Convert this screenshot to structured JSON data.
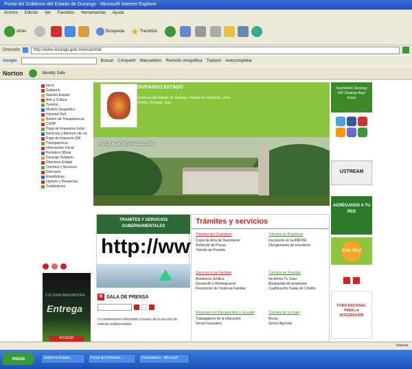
{
  "window": {
    "title": "Portal del Gobierno del Estado de Durango - Microsoft Internet Explorer"
  },
  "menu": [
    "Archivo",
    "Edición",
    "Ver",
    "Favoritos",
    "Herramientas",
    "Ayuda"
  ],
  "toolbar": {
    "back": "Atrás",
    "search": "Búsqueda",
    "favorites": "Favoritos"
  },
  "address": {
    "label": "Dirección",
    "url": "http://www.durango.gob.mx/es/portal/"
  },
  "google": {
    "label": "Google",
    "search_btn": "Buscar",
    "items": [
      "Compartir",
      "Marcadores",
      "Revisión ortográfica",
      "Traducir",
      "Autocompletar"
    ]
  },
  "norton": {
    "label": "Norton",
    "safe_web": "Identity Safe"
  },
  "leftnav": {
    "items": [
      "Inicio",
      "Gobierno",
      "Nuestro Estado",
      "Arte y Cultura",
      "Turismo",
      "Modelo Geográfico",
      "Historial Civil",
      "Boletín de Transparencia",
      "CURP",
      "Pago de Impuestos Estat.",
      "Servicios y Atención de ciu.",
      "Pago de Impuesto ISN",
      "Transparencia",
      "Información Fiscal",
      "Periódico Oficial",
      "Durango Solidario",
      "Directorio Estatal",
      "Trámites y Servicios",
      "Directorio",
      "Estadísticas",
      "Opinión y Denuncias",
      "Contáctenos"
    ]
  },
  "banner": {
    "line1": "CULTURA INNOVADORA",
    "line2": "Entrega",
    "btn": "ACCESO"
  },
  "header": {
    "title": "DURANGO ESTADO",
    "text": "Gobierno del Estado de Durango, Palacio de Gobierno, Zona Centro, Durango, Dgo."
  },
  "photo": {
    "label": "HACIENDA DE GUADALUPE"
  },
  "tramites_banner": {
    "line1": "TRAMITES Y SERVICIOS",
    "line2": "GUBERNAMENTALES",
    "http": "http://www"
  },
  "sala": {
    "icon": "N",
    "title": "SALA DE PRENSA",
    "text": "Lo mantenemos informado a través de la sección de noticias institucionales."
  },
  "tramites": {
    "title": "Trámites y servicios",
    "sections": [
      {
        "heading": "Trámites del Ciudadano",
        "items": [
          "Copia de Acta de Nacimiento",
          "Refrendo de Placas",
          "Trámite de Pensión"
        ]
      },
      {
        "heading": "Trámites de Empresas",
        "items": [
          "Inscripción en la ANFIDE",
          "Otorgamiento de Incentivos"
        ]
      },
      {
        "heading": "Servicios a las Familias",
        "items": [
          "Asistencia Jurídica",
          "Desarrollo y Reintegración",
          "Prevención de Violencia Familiar"
        ]
      },
      {
        "heading": "Trámites de Vivienda",
        "items": [
          "Iniciemos Tu Casa",
          "Búsquedas de propiedad",
          "Cualificación Casas de Crédito"
        ]
      },
      {
        "heading": "Personas con Discapacidad y 3a edad",
        "items": [
          "Trabajadores de la educación",
          "Sector Ganadero"
        ]
      },
      {
        "heading": "Trámites de la mujer",
        "items": [
          "Becas",
          "Sector Agrícola"
        ]
      }
    ]
  },
  "right": {
    "top": "Nacimiento Durango 450 Durango Aquí Estoy",
    "ustream": "USTREAM",
    "green": "AGRÉGANOS A TU RED",
    "cuc": "CUC 2011",
    "foro": "FORO NACIONAL PARA LA INTEGRACIÓN"
  },
  "status": {
    "zone": "Internet"
  },
  "taskbar": {
    "start": "Inicio",
    "tasks": [
      "Gobierno Estado...",
      "Portal del Gobierno...",
      "Documento1 - Microsoft"
    ]
  }
}
